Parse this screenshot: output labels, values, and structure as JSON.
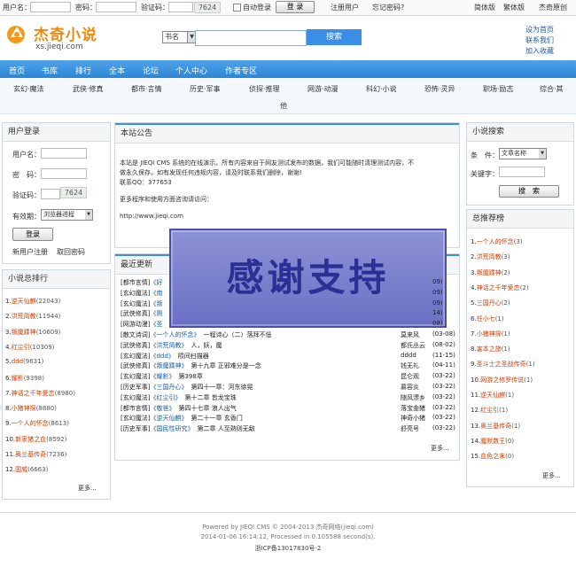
{
  "topbar": {
    "username_label": "用户名：",
    "password_label": "密码：",
    "captcha_label": "验证码：",
    "captcha_text": "7624",
    "auto_login_label": "自动登录",
    "login_button": "登 录",
    "register_link": "注册用户",
    "forgot_link": "忘记密码?",
    "simplified": "简体版",
    "traditional": "繁体版",
    "original": "杰奇原创"
  },
  "header": {
    "logo_title": "杰奇小说",
    "logo_url": "xs.jieqi.com",
    "search_select": "书名",
    "search_button": "搜索",
    "right_links": [
      "设为首页",
      "联系我们",
      "加入收藏"
    ]
  },
  "nav": [
    "首页",
    "书库",
    "排行",
    "全本",
    "论坛",
    "个人中心",
    "作者专区"
  ],
  "subnav": [
    "玄幻·魔法",
    "武侠·修真",
    "都市·言情",
    "历史·军事",
    "侦探·推理",
    "网游·动漫",
    "科幻·小说",
    "恐怖·灵异",
    "职场·励志",
    "综合·其"
  ],
  "subnav_wrap": "他",
  "login_panel": {
    "title": "用户登录",
    "username": "用户名：",
    "password": "密　码：",
    "captcha": "验证码：",
    "captcha_text": "7624",
    "expiry": "有效期：",
    "expiry_value": "浏览器进程",
    "login_button": "登录",
    "register": "新用户注册",
    "recover": "取回密码"
  },
  "ranking_panel": {
    "title": "小说总排行",
    "items": [
      {
        "n": "1.",
        "t": "逆天仙麒",
        "c": "(22043)"
      },
      {
        "n": "2.",
        "t": "洪荒简教",
        "c": "(11944)"
      },
      {
        "n": "3.",
        "t": "叛魔蹂神",
        "c": "(10609)"
      },
      {
        "n": "4.",
        "t": "红尘引",
        "c": "(10309)"
      },
      {
        "n": "5.",
        "t": "ddd",
        "c": "(9631)"
      },
      {
        "n": "6.",
        "t": "耀影",
        "c": "(9398)"
      },
      {
        "n": "7.",
        "t": "神话之千年爱恋",
        "c": "(8980)"
      },
      {
        "n": "8.",
        "t": "小猪神探",
        "c": "(8880)"
      },
      {
        "n": "9.",
        "t": "一个人的怀念",
        "c": "(8613)"
      },
      {
        "n": "10.",
        "t": "新家猪之血",
        "c": "(8592)"
      },
      {
        "n": "11.",
        "t": "奥兰基传奇",
        "c": "(7236)"
      },
      {
        "n": "12.",
        "t": "国威",
        "c": "(6663)"
      }
    ],
    "more": "更多..."
  },
  "notice_panel": {
    "title": "本站公告",
    "line1": "本站是 JIEQI CMS 系统的在线演示。所有内容来自于网友测试发布的数据，我们可能随时清理测试内容，不",
    "line2": "做永久保存。如有发现任何违规内容，请及时联系我们删除，谢谢!",
    "line3": "联系QQ：377653",
    "line4": "更多程序和使用方面咨询请访问：",
    "line5": "http://www.jieqi.com"
  },
  "updates_panel": {
    "title": "最近更新",
    "rows": [
      {
        "cat": "[都市言情]",
        "book": "《好",
        "rest": ""
      },
      {
        "cat": "[玄幻魔法]",
        "book": "《南",
        "rest": ""
      },
      {
        "cat": "[玄幻魔法]",
        "book": "《叛",
        "rest": ""
      },
      {
        "cat": "[武侠修真]",
        "book": "《爬",
        "rest": ""
      },
      {
        "cat": "[网游动漫]",
        "book": "《圣",
        "rest": ""
      },
      {
        "cat": "[散文诗词]",
        "book": "《一个人的怀念》",
        "rest": "一程诗心（二）落拜不低"
      },
      {
        "cat": "[武侠修真]",
        "book": "《洪荒简教》",
        "rest": "人，妖，魔"
      },
      {
        "cat": "[玄幻魔法]",
        "book": "《ddd》",
        "rest": "陨间扫描器"
      },
      {
        "cat": "[武侠修真]",
        "book": "《叛魔蹂神》",
        "rest": "第十九章 正邪难分是一念"
      },
      {
        "cat": "[玄幻魔法]",
        "book": "《耀影》",
        "rest": "第398章"
      },
      {
        "cat": "[历史军事]",
        "book": "《三国丹心》",
        "rest": "第四十一章：河东徐晃"
      },
      {
        "cat": "[玄幻魔法]",
        "book": "《红尘引》",
        "rest": "第十二章 皆龙宝珠"
      },
      {
        "cat": "[都市言情]",
        "book": "《敬爸》",
        "rest": "第四十七章 浪人出气"
      },
      {
        "cat": "[玄幻魔法]",
        "book": "《逆天仙麒》",
        "rest": "第二十一章 玄香门"
      },
      {
        "cat": "[历史军事]",
        "book": "《国民性研究》",
        "rest": "第二章 人至熟则无敌"
      }
    ],
    "right": [
      {
        "author": "",
        "date": "09)"
      },
      {
        "author": "",
        "date": "09)"
      },
      {
        "author": "",
        "date": "09)"
      },
      {
        "author": "",
        "date": "14)"
      },
      {
        "author": "",
        "date": "08)"
      },
      {
        "author": "莫来风",
        "date": "(03-08)"
      },
      {
        "author": "都氏丛云",
        "date": "(08-02)"
      },
      {
        "author": "dddd",
        "date": "(11-15)"
      },
      {
        "author": "钱无礼",
        "date": "(04-11)"
      },
      {
        "author": "昆仑观",
        "date": "(03-22)"
      },
      {
        "author": "慕容炎",
        "date": "(03-22)"
      },
      {
        "author": "随风漂乡",
        "date": "(03-22)"
      },
      {
        "author": "落宝金猪",
        "date": "(03-22)"
      },
      {
        "author": "神奇小猪",
        "date": "(03-22)"
      },
      {
        "author": "舒亮号",
        "date": "(03-22)"
      }
    ],
    "more": "更多..."
  },
  "search_panel": {
    "title": "小说搜索",
    "condition": "条　件：",
    "select_value": "文章名称",
    "keyword": "关键字：",
    "button": "搜　索"
  },
  "recommend_panel": {
    "title": "总推荐榜",
    "items": [
      {
        "n": "1.",
        "t": "一个人的怀念",
        "c": "(3)"
      },
      {
        "n": "2.",
        "t": "洪荒简教",
        "c": "(3)"
      },
      {
        "n": "3.",
        "t": "叛魔蹂神",
        "c": "(2)"
      },
      {
        "n": "4.",
        "t": "神话之千年爱恋",
        "c": "(2)"
      },
      {
        "n": "5.",
        "t": "三国丹心",
        "c": "(2)"
      },
      {
        "n": "6.",
        "t": "任小七",
        "c": "(1)"
      },
      {
        "n": "7.",
        "t": "小猪神探",
        "c": "(1)"
      },
      {
        "n": "8.",
        "t": "害本之旅",
        "c": "(1)"
      },
      {
        "n": "9.",
        "t": "圣斗士之圣战传奇",
        "c": "(1)"
      },
      {
        "n": "10.",
        "t": "网游之修罗传说",
        "c": "(1)"
      },
      {
        "n": "11.",
        "t": "逆天仙麒",
        "c": "(1)"
      },
      {
        "n": "12.",
        "t": "红尘引",
        "c": "(1)"
      },
      {
        "n": "13.",
        "t": "奥兰基传奇",
        "c": "(1)"
      },
      {
        "n": "14.",
        "t": "魔默数王",
        "c": "(0)"
      },
      {
        "n": "15.",
        "t": "血色之末",
        "c": "(0)"
      }
    ],
    "more": "更多..."
  },
  "overlay_text": "感谢支持",
  "footer": {
    "line1": "Powered by JIEQI CMS © 2004-2013 杰奇网络(jieqi.com)",
    "line2": "2014-01-06 16:14:12, Processed in 0.105588 second(s).",
    "line3": "浙ICP备13017830号-2"
  },
  "colors": {
    "brand": "#f08a12",
    "nav": "#3a8ee6",
    "rank": "#d43c00",
    "link": "#1a5fa8"
  }
}
